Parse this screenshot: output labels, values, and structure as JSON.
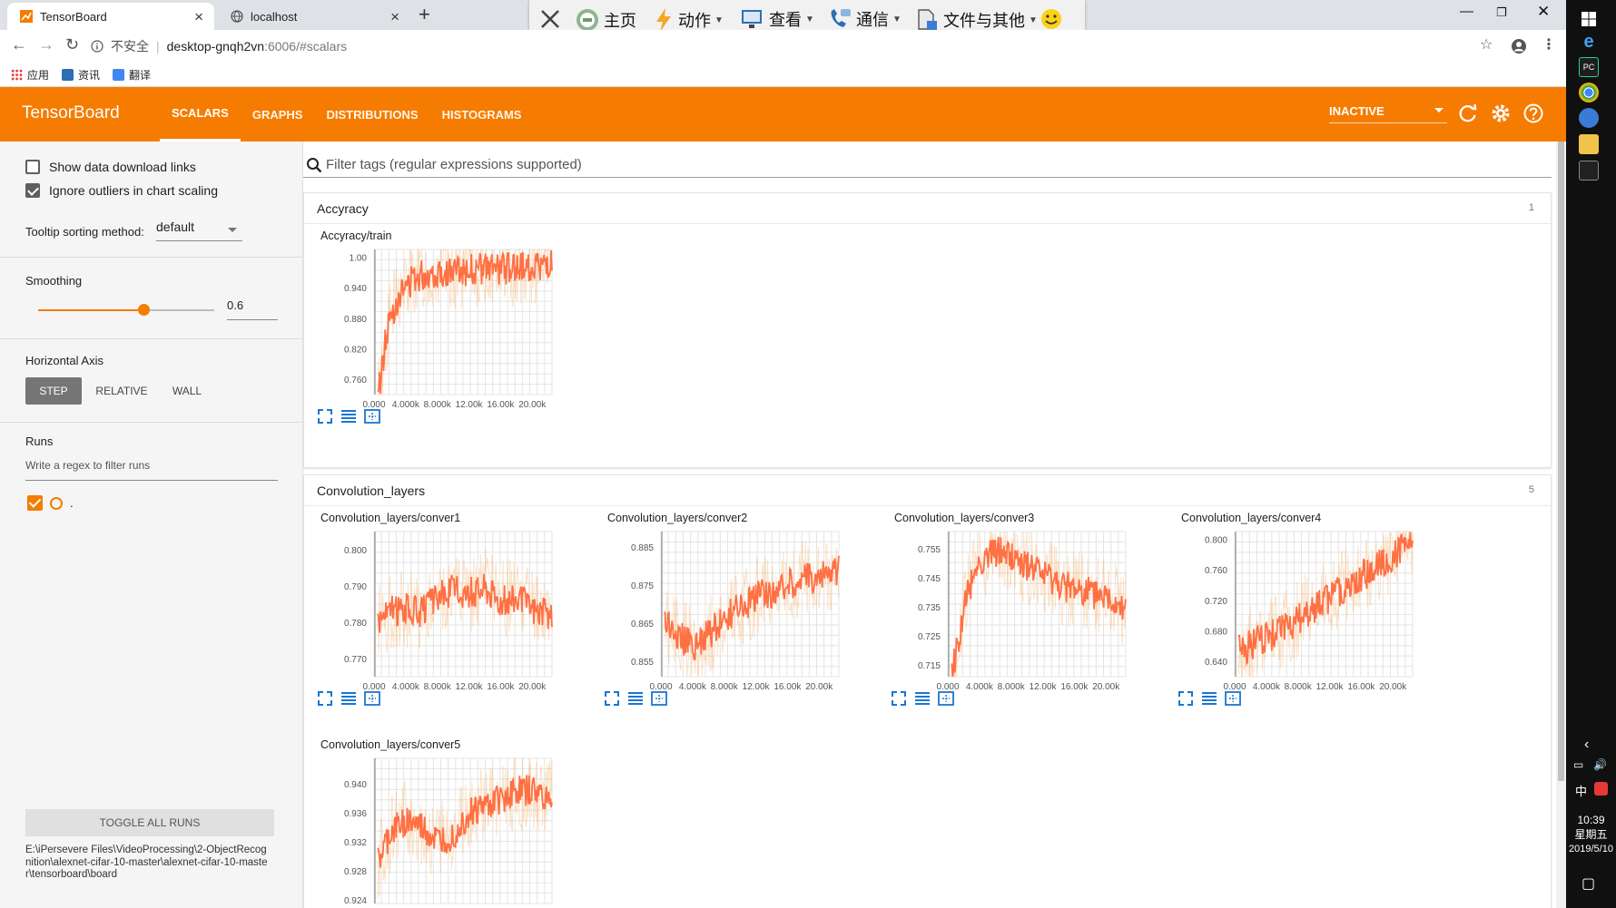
{
  "browser": {
    "tabs": [
      {
        "title": "TensorBoard",
        "active": true
      },
      {
        "title": "localhost",
        "active": false
      }
    ],
    "insecure_label": "不安全",
    "url_host": "desktop-gnqh2vn",
    "url_rest": ":6006/#scalars",
    "bookmarks": [
      "应用",
      "资讯",
      "翻译"
    ]
  },
  "remote_toolbar": {
    "items": [
      "主页",
      "动作",
      "查看",
      "通信",
      "文件与其他"
    ]
  },
  "tensorboard": {
    "brand": "TensorBoard",
    "tabs": [
      "SCALARS",
      "GRAPHS",
      "DISTRIBUTIONS",
      "HISTOGRAMS"
    ],
    "run_status": "INACTIVE",
    "accent": "#f57c00"
  },
  "sidebar": {
    "show_download": "Show data download links",
    "ignore_outliers": "Ignore outliers in chart scaling",
    "show_download_checked": false,
    "ignore_outliers_checked": true,
    "tooltip_label": "Tooltip sorting method:",
    "tooltip_value": "default",
    "smoothing_label": "Smoothing",
    "smoothing_value": "0.6",
    "smoothing_fraction": 0.6,
    "horizontal_axis_label": "Horizontal Axis",
    "axis_buttons": [
      "STEP",
      "RELATIVE",
      "WALL"
    ],
    "axis_selected": "STEP",
    "runs_label": "Runs",
    "runs_filter_placeholder": "Write a regex to filter runs",
    "run_name": ".",
    "toggle_all": "TOGGLE ALL RUNS",
    "logdir": "E:\\iPersevere Files\\VideoProcessing\\2-ObjectRecognition\\alexnet-cifar-10-master\\alexnet-cifar-10-master\\tensorboard\\board"
  },
  "main": {
    "filter_placeholder": "Filter tags (regular expressions supported)",
    "categories": [
      {
        "name": "Accyracy",
        "count": "1"
      },
      {
        "name": "Convolution_layers",
        "count": "5"
      }
    ]
  },
  "chart_data": [
    {
      "type": "line",
      "title": "Accyracy/train",
      "series_color": "#ff7043",
      "x_ticks": [
        "0.000",
        "4.000k",
        "8.000k",
        "12.00k",
        "16.00k",
        "20.00k"
      ],
      "y_ticks": [
        "1.00",
        "0.940",
        "0.880",
        "0.820",
        "0.760"
      ],
      "xlim": [
        0,
        22500
      ],
      "ylim": [
        0.73,
        1.015
      ],
      "x": [
        500,
        1000,
        1500,
        2000,
        3000,
        4000,
        5000,
        6000,
        8000,
        10000,
        12000,
        14000,
        16000,
        18000,
        20000,
        22500
      ],
      "y": [
        0.73,
        0.78,
        0.84,
        0.88,
        0.92,
        0.94,
        0.96,
        0.965,
        0.97,
        0.972,
        0.975,
        0.978,
        0.976,
        0.98,
        0.982,
        0.985
      ]
    },
    {
      "type": "line",
      "title": "Convolution_layers/conver1",
      "series_color": "#ff7043",
      "x_ticks": [
        "0.000",
        "4.000k",
        "8.000k",
        "12.00k",
        "16.00k",
        "20.00k"
      ],
      "y_ticks": [
        "0.800",
        "0.790",
        "0.780",
        "0.770"
      ],
      "xlim": [
        0,
        22500
      ],
      "ylim": [
        0.765,
        0.805
      ],
      "x": [
        500,
        2000,
        4000,
        6000,
        8000,
        10000,
        12000,
        14000,
        16000,
        18000,
        20000,
        22500
      ],
      "y": [
        0.781,
        0.783,
        0.784,
        0.783,
        0.787,
        0.789,
        0.788,
        0.79,
        0.786,
        0.787,
        0.784,
        0.782
      ]
    },
    {
      "type": "line",
      "title": "Convolution_layers/conver2",
      "series_color": "#ff7043",
      "x_ticks": [
        "0.000",
        "4.000k",
        "8.000k",
        "12.00k",
        "16.00k",
        "20.00k"
      ],
      "y_ticks": [
        "0.885",
        "0.875",
        "0.865",
        "0.855"
      ],
      "xlim": [
        0,
        22500
      ],
      "ylim": [
        0.851,
        0.889
      ],
      "x": [
        500,
        2000,
        4000,
        6000,
        8000,
        10000,
        12000,
        14000,
        16000,
        18000,
        20000,
        22500
      ],
      "y": [
        0.866,
        0.862,
        0.859,
        0.862,
        0.866,
        0.869,
        0.872,
        0.873,
        0.875,
        0.877,
        0.877,
        0.879
      ]
    },
    {
      "type": "line",
      "title": "Convolution_layers/conver3",
      "series_color": "#ff7043",
      "x_ticks": [
        "0.000",
        "4.000k",
        "8.000k",
        "12.00k",
        "16.00k",
        "20.00k"
      ],
      "y_ticks": [
        "0.755",
        "0.745",
        "0.735",
        "0.725",
        "0.715"
      ],
      "xlim": [
        0,
        22500
      ],
      "ylim": [
        0.711,
        0.761
      ],
      "x": [
        500,
        1500,
        2500,
        3500,
        5000,
        6500,
        8000,
        10000,
        12000,
        14000,
        16000,
        18000,
        20000,
        22500
      ],
      "y": [
        0.712,
        0.725,
        0.74,
        0.748,
        0.752,
        0.754,
        0.752,
        0.749,
        0.746,
        0.743,
        0.741,
        0.74,
        0.738,
        0.735
      ]
    },
    {
      "type": "line",
      "title": "Convolution_layers/conver4",
      "series_color": "#ff7043",
      "x_ticks": [
        "0.000",
        "4.000k",
        "8.000k",
        "12.00k",
        "16.00k",
        "20.00k"
      ],
      "y_ticks": [
        "0.800",
        "0.760",
        "0.720",
        "0.680",
        "0.640"
      ],
      "xlim": [
        0,
        22500
      ],
      "ylim": [
        0.62,
        0.81
      ],
      "x": [
        500,
        1500,
        3000,
        5000,
        7000,
        9000,
        11000,
        13000,
        15000,
        17000,
        19000,
        21000,
        22500
      ],
      "y": [
        0.655,
        0.658,
        0.667,
        0.676,
        0.688,
        0.702,
        0.716,
        0.73,
        0.744,
        0.758,
        0.772,
        0.786,
        0.796
      ]
    },
    {
      "type": "line",
      "title": "Convolution_layers/conver5",
      "series_color": "#ff7043",
      "x_ticks": [
        "0.000",
        "4.000k",
        "8.000k",
        "12.00k",
        "16.00k",
        "20.00k"
      ],
      "y_ticks": [
        "0.940",
        "0.936",
        "0.932",
        "0.928",
        "0.924"
      ],
      "xlim": [
        0,
        22500
      ],
      "ylim": [
        0.9235,
        0.9435
      ],
      "x": [
        500,
        2000,
        4000,
        6000,
        8000,
        10000,
        12000,
        14000,
        16000,
        18000,
        20000,
        22500
      ],
      "y": [
        0.929,
        0.933,
        0.935,
        0.934,
        0.932,
        0.933,
        0.936,
        0.937,
        0.938,
        0.939,
        0.939,
        0.938
      ]
    }
  ],
  "taskbar": {
    "time": "10:39",
    "weekday": "星期五",
    "date": "2019/5/10",
    "ime": "中"
  }
}
